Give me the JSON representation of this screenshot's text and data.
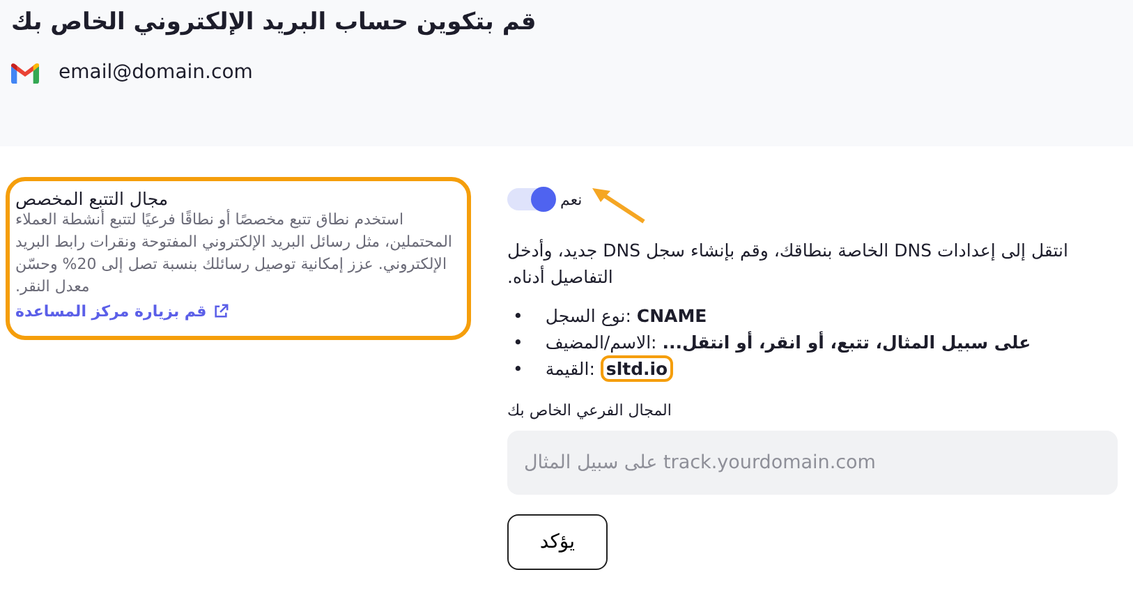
{
  "header": {
    "title": "قم بتكوين حساب البريد الإلكتروني الخاص بك",
    "account": "email@domain.com"
  },
  "tip_card": {
    "highlighted": true,
    "title": "مجال التتبع المخصص",
    "body": "استخدم نطاق تتبع مخصصًا أو نطاقًا فرعيًا لتتبع أنشطة العملاء المحتملين، مثل رسائل البريد الإلكتروني المفتوحة ونقرات رابط البريد الإلكتروني. عزز إمكانية توصيل رسائلك بنسبة تصل إلى 20% وحسّن معدل النقر.",
    "link": "قم بزيارة مركز المساعدة"
  },
  "toggle": {
    "on": true,
    "label": "نعم"
  },
  "instructions": "انتقل إلى إعدادات DNS الخاصة بنطاقك، وقم بإنشاء سجل DNS جديد، وأدخل التفاصيل أدناه.",
  "records": [
    {
      "marker": "•",
      "text": "نوع السجل: **CNAME**",
      "highlighted": false
    },
    {
      "marker": "•",
      "text": "الاسم/المضيف: **على سبيل المثال، تتبع، أو انقر، أو انتقل...**",
      "highlighted": false
    },
    {
      "marker": "•",
      "text": "القيمة: **sltd.io**",
      "highlighted": true
    }
  ],
  "subdomain_field": {
    "label": "المجال الفرعي الخاص بك",
    "placeholder": "على سبيل المثال track.yourdomain.com"
  },
  "buttons": [
    "يؤكد"
  ]
}
